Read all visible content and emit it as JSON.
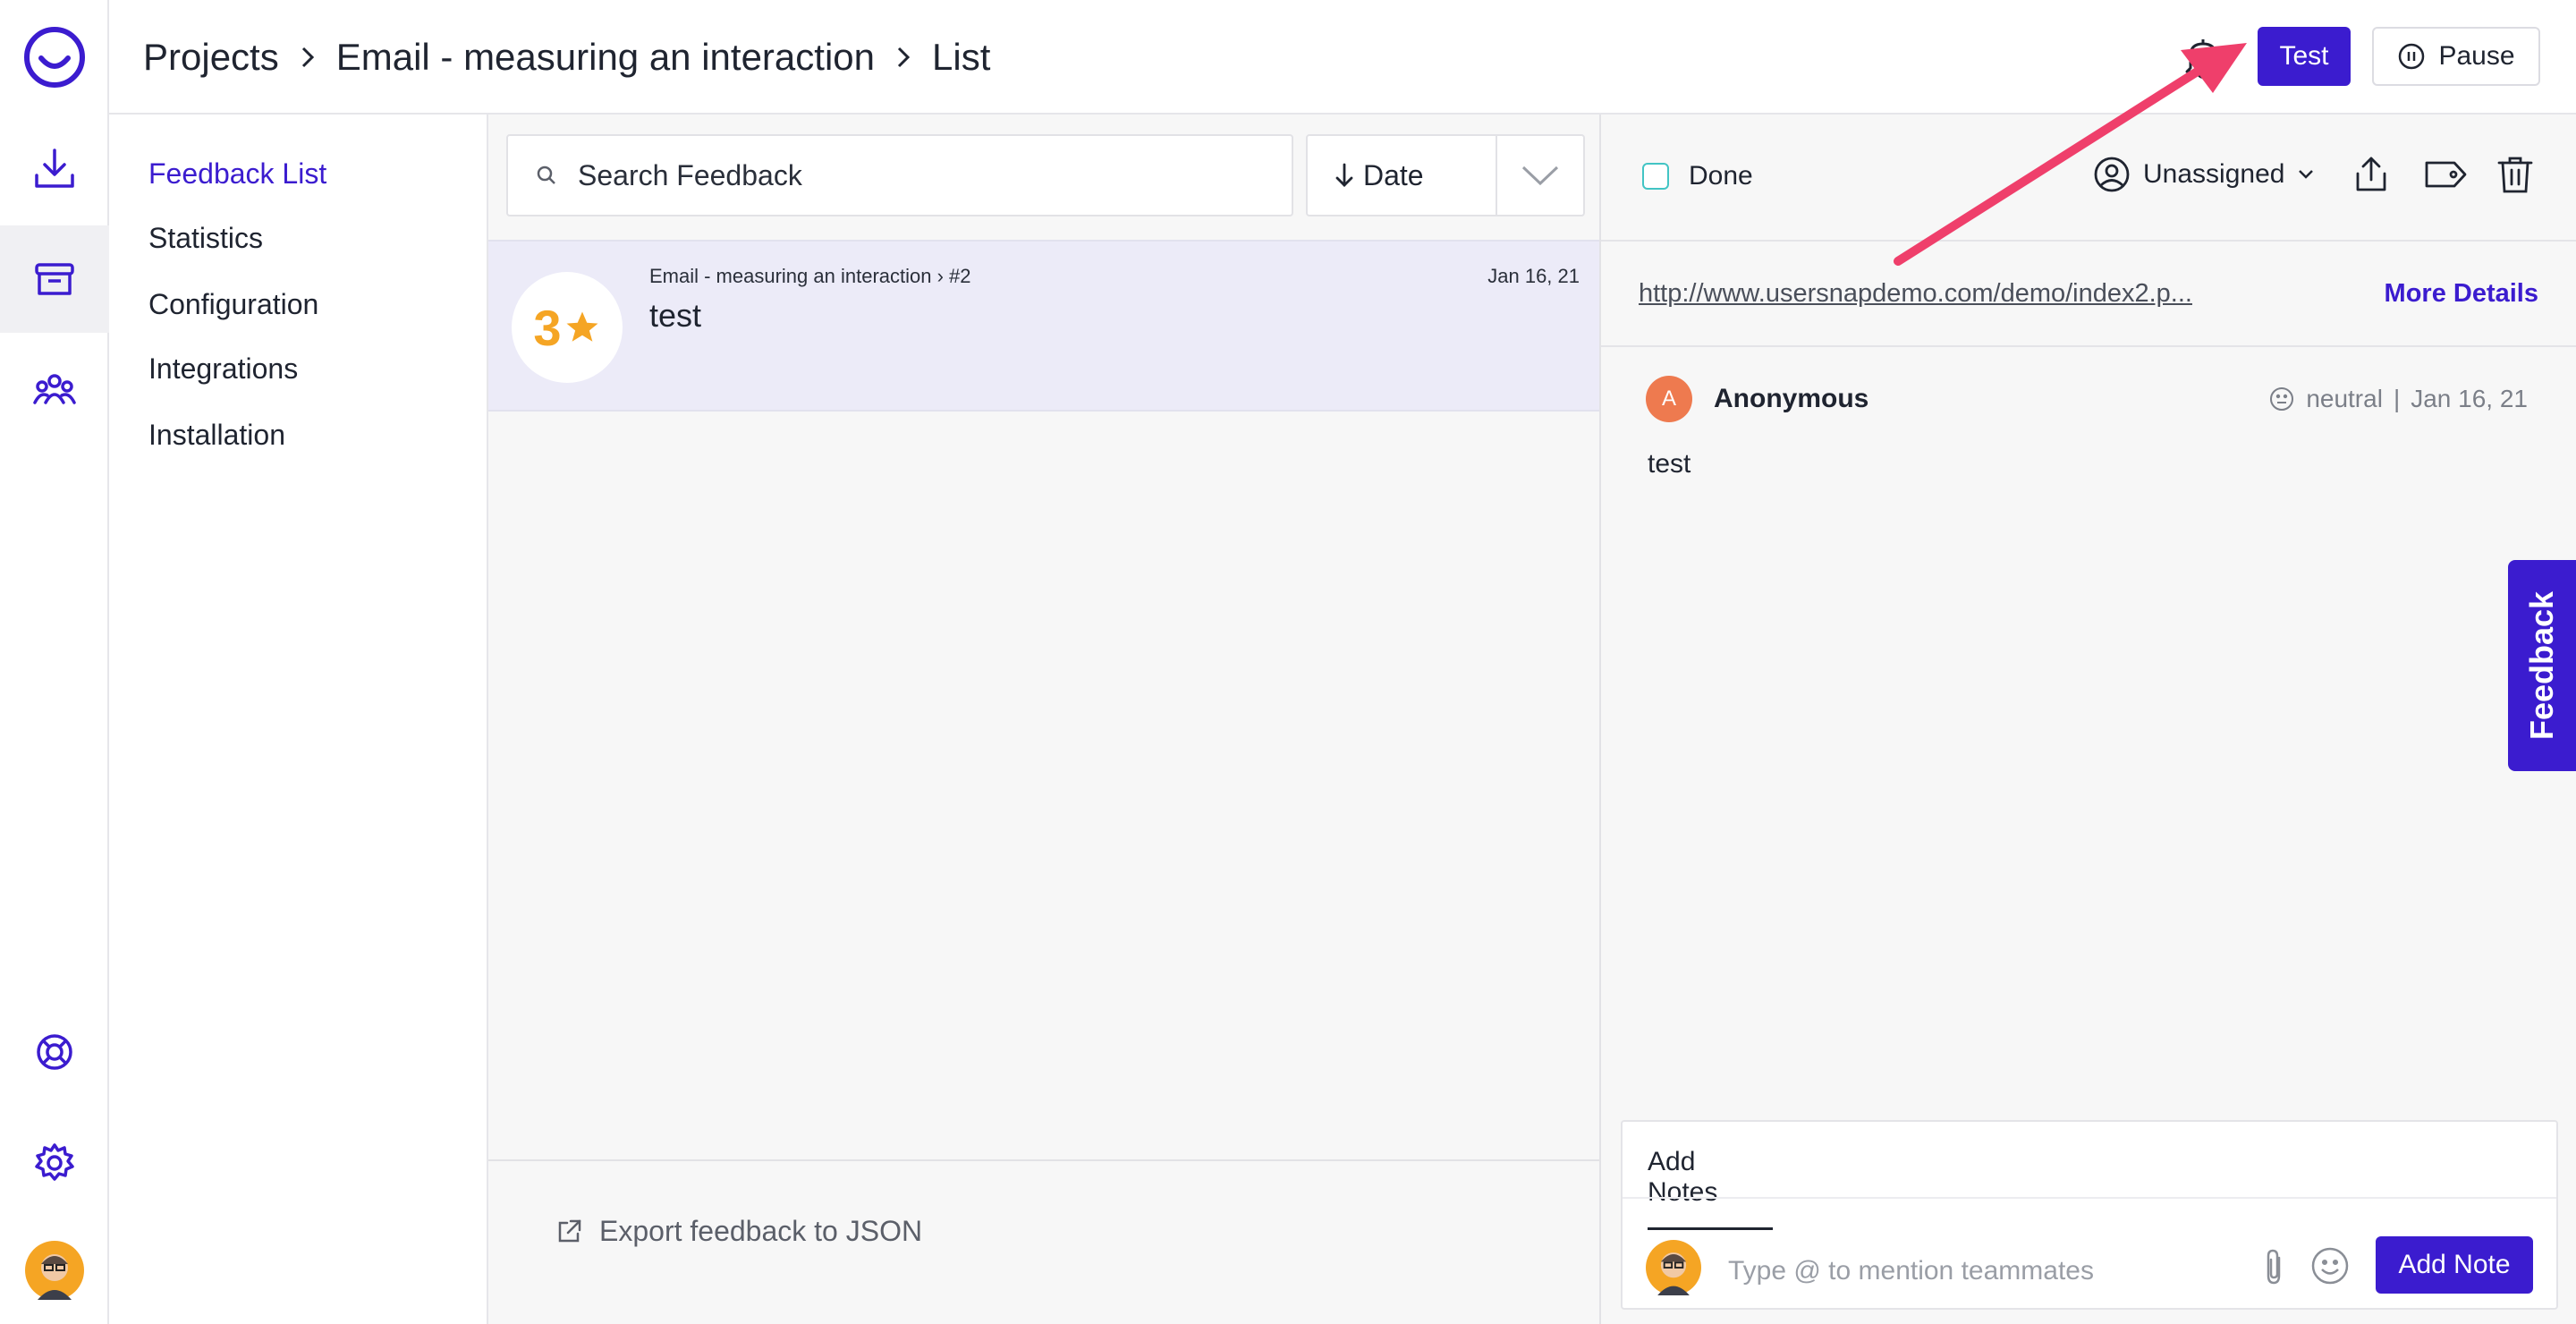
{
  "header": {
    "breadcrumb": [
      "Projects",
      "Email - measuring an interaction",
      "List"
    ],
    "test_label": "Test",
    "pause_label": "Pause"
  },
  "rail": {
    "icons": [
      "logo-icon",
      "download-icon",
      "inbox-icon",
      "people-icon",
      "help-icon",
      "gear-icon",
      "avatar"
    ]
  },
  "subnav": {
    "items": [
      "Feedback List",
      "Statistics",
      "Configuration",
      "Integrations",
      "Installation"
    ],
    "active": "Feedback List"
  },
  "list": {
    "search_placeholder": "Search Feedback",
    "sort_label": "Date",
    "items": [
      {
        "rating": "3",
        "meta": "Email - measuring an interaction › #2",
        "title": "test",
        "date": "Jan 16, 21"
      }
    ],
    "export_label": "Export feedback to JSON"
  },
  "detail": {
    "done_label": "Done",
    "assignee_label": "Unassigned",
    "url": "http://www.usersnapdemo.com/demo/index2.p...",
    "more_details_label": "More Details",
    "comment": {
      "avatar_letter": "A",
      "author": "Anonymous",
      "sentiment": "neutral",
      "date": "Jan 16, 21",
      "body": "test"
    },
    "notes": {
      "tab_label": "Add Notes",
      "placeholder": "Type @ to mention teammates",
      "add_note_label": "Add Note"
    }
  },
  "side_tab_label": "Feedback",
  "colors": {
    "accent": "#3b1ccf",
    "selected_row": "#ecebf8",
    "rating_star": "#f5a524",
    "annotation_arrow": "#ef3f6b"
  }
}
